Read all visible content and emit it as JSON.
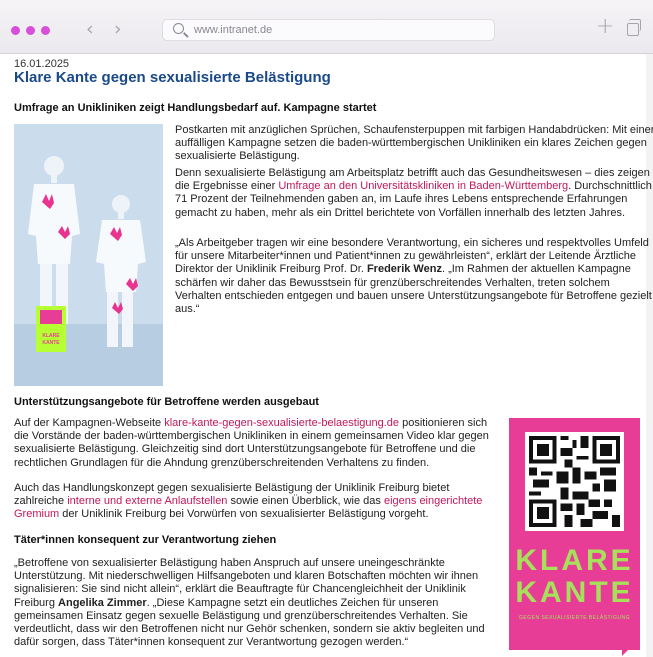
{
  "browser": {
    "url": "www.intranet.de",
    "back_icon": "chevron-left-icon",
    "forward_icon": "chevron-right-icon",
    "new_tab_icon": "plus-icon",
    "tabs_icon": "tabs-overview-icon",
    "traffic_light_color": "#d64ed9"
  },
  "article": {
    "date": "16.01.2025",
    "title": "Klare Kante gegen sexualisierte Belästigung",
    "subtitle": "Umfrage an Unikliniken zeigt Handlungsbedarf auf. Kampagne startet",
    "intro_p1": "Postkarten mit anzüglichen Sprüchen, Schaufensterpuppen mit farbigen Handabdrücken: Mit einer auffälligen Kampagne setzen die baden-württembergischen Unikliniken ein klares Zeichen gegen sexualisierte Belästigung.",
    "intro_p2_a": "Denn sexualisierte Belästigung am Arbeitsplatz betrifft auch das Gesundheitswesen – dies zeigen die Ergebnisse einer ",
    "intro_p2_link": "Umfrage an den Universitätskliniken in Baden-Württemberg",
    "intro_p2_b": ". Durchschnittlich 71 Prozent der Teilnehmenden gaben an, im Laufe ihres Lebens entsprechende Erfahrungen gemacht zu haben, mehr als ein Drittel berichtete von Vorfällen innerhalb des letzten Jahres.",
    "intro_p3_a": "„Als Arbeitgeber tragen wir eine besondere Verantwortung, ein sicheres und respektvolles Umfeld für unsere Mitarbeiter*innen und Patient*innen zu gewährleisten“, erklärt der Leitende Ärztliche Direktor der Uniklinik Freiburg Prof. Dr. ",
    "intro_p3_name": "Frederik Wenz",
    "intro_p3_b": ". „Im Rahmen der aktuellen Kampagne schärfen wir daher das Bewusstsein für grenzüberschreitendes Verhalten, treten solchem Verhalten entschieden entgegen und bauen unsere Unterstützungsangebote für Betroffene gezielt aus.“",
    "section2_heading": "Unterstützungsangebote für Betroffene werden ausgebaut",
    "s2_p1_a": "Auf der Kampagnen-Webseite ",
    "s2_p1_link": "klare-kante-gegen-sexualisierte-belaestigung.de",
    "s2_p1_b": " positionieren sich die Vorstände der baden-württembergischen Unikliniken in einem gemeinsamen Video klar gegen sexualisierte Belästigung. Gleichzeitig sind dort Unterstützungsangebote für Betroffene und die rechtlichen Grundlagen für die Ahndung grenzüberschreitenden Verhaltens zu finden.",
    "s2_p2_a": "Auch das Handlungskonzept gegen sexualisierte Belästigung der Uniklinik Freiburg bietet zahlreiche ",
    "s2_p2_link1": "interne und externe Anlaufstellen",
    "s2_p2_b": " sowie einen Überblick, wie das ",
    "s2_p2_link2": "eigens eingerichtete Gremium",
    "s2_p2_c": " der Uniklinik Freiburg bei Vorwürfen von sexualisierter Belästigung vorgeht.",
    "section3_heading": "Täter*innen konsequent zur Verantwortung ziehen",
    "s3_p1_a": "„Betroffene von sexualisierter Belästigung haben Anspruch auf unsere uneingeschränkte Unterstützung. Mit niederschwelligen Hilfsangeboten und klaren Botschaften möchten wir ihnen signalisieren: Sie sind nicht allein“, erklärt die Beauftragte für Chancengleichheit der Uniklinik Freiburg ",
    "s3_p1_name": "Angelika Zimmer",
    "s3_p1_b": ". „Diese Kampagne setzt ein deutliches Zeichen für unseren gemeinsamen Einsatz gegen sexuelle Belästigung und grenzüberschreitendes Verhalten. Sie verdeutlicht, dass wir den Betroffenen nicht nur Gehör schenken, sondern sie aktiv begleiten und dafür sorgen, dass Täter*innen konsequent zur Verantwortung gezogen werden.“"
  },
  "poster": {
    "line1": "KLARE",
    "line2": "KANTE",
    "subline": "GEGEN SEXUALISIERTE BELÄSTIGUNG",
    "bg_color": "#e83d96",
    "text_color": "#a7e05a"
  },
  "photo_card": {
    "line1": "KLARE",
    "line2": "KANTE",
    "color": "#b6ff33"
  }
}
